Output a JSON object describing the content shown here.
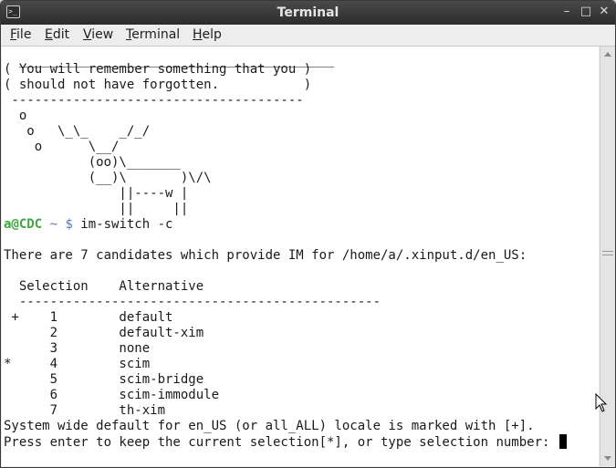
{
  "window": {
    "title": "Terminal"
  },
  "titlebar": {
    "icon": "terminal-app-icon",
    "buttons": [
      "minimize-icon",
      "maximize-icon",
      "close-icon"
    ],
    "minimize_glyph": "–",
    "maximize_glyph": "□",
    "close_glyph": "✕"
  },
  "menubar": {
    "items": [
      {
        "accel": "F",
        "rest": "ile"
      },
      {
        "accel": "E",
        "rest": "dit"
      },
      {
        "accel": "V",
        "rest": "iew"
      },
      {
        "accel": "T",
        "rest": "erminal"
      },
      {
        "accel": "H",
        "rest": "elp"
      }
    ]
  },
  "terminal": {
    "lines": [
      "  _________________________________________",
      "( You will remember something that you )",
      "( should not have forgotten.           )",
      " --------------------------------------",
      "  o",
      "   o   \\_\\_    _/_/",
      "    o      \\__/",
      "           (oo)\\_______",
      "           (__)\\       )\\/\\",
      "               ||----w |",
      "               ||     ||",
      "",
      "",
      "There are 7 candidates which provide IM for /home/a/.xinput.d/en_US:",
      "",
      "  Selection    Alternative",
      "  -----------------------------------------------",
      " +    1        default",
      "      2        default-xim",
      "      3        none",
      "*     4        scim",
      "      5        scim-bridge",
      "      6        scim-immodule",
      "      7        th-xim",
      "System wide default for en_US (or all_ALL) locale is marked with [+].",
      "Press enter to keep the current selection[*], or type selection number: "
    ],
    "prompt": {
      "user": "a@CDC",
      "tilde": " ~ $",
      "command": " im-switch -c"
    }
  }
}
